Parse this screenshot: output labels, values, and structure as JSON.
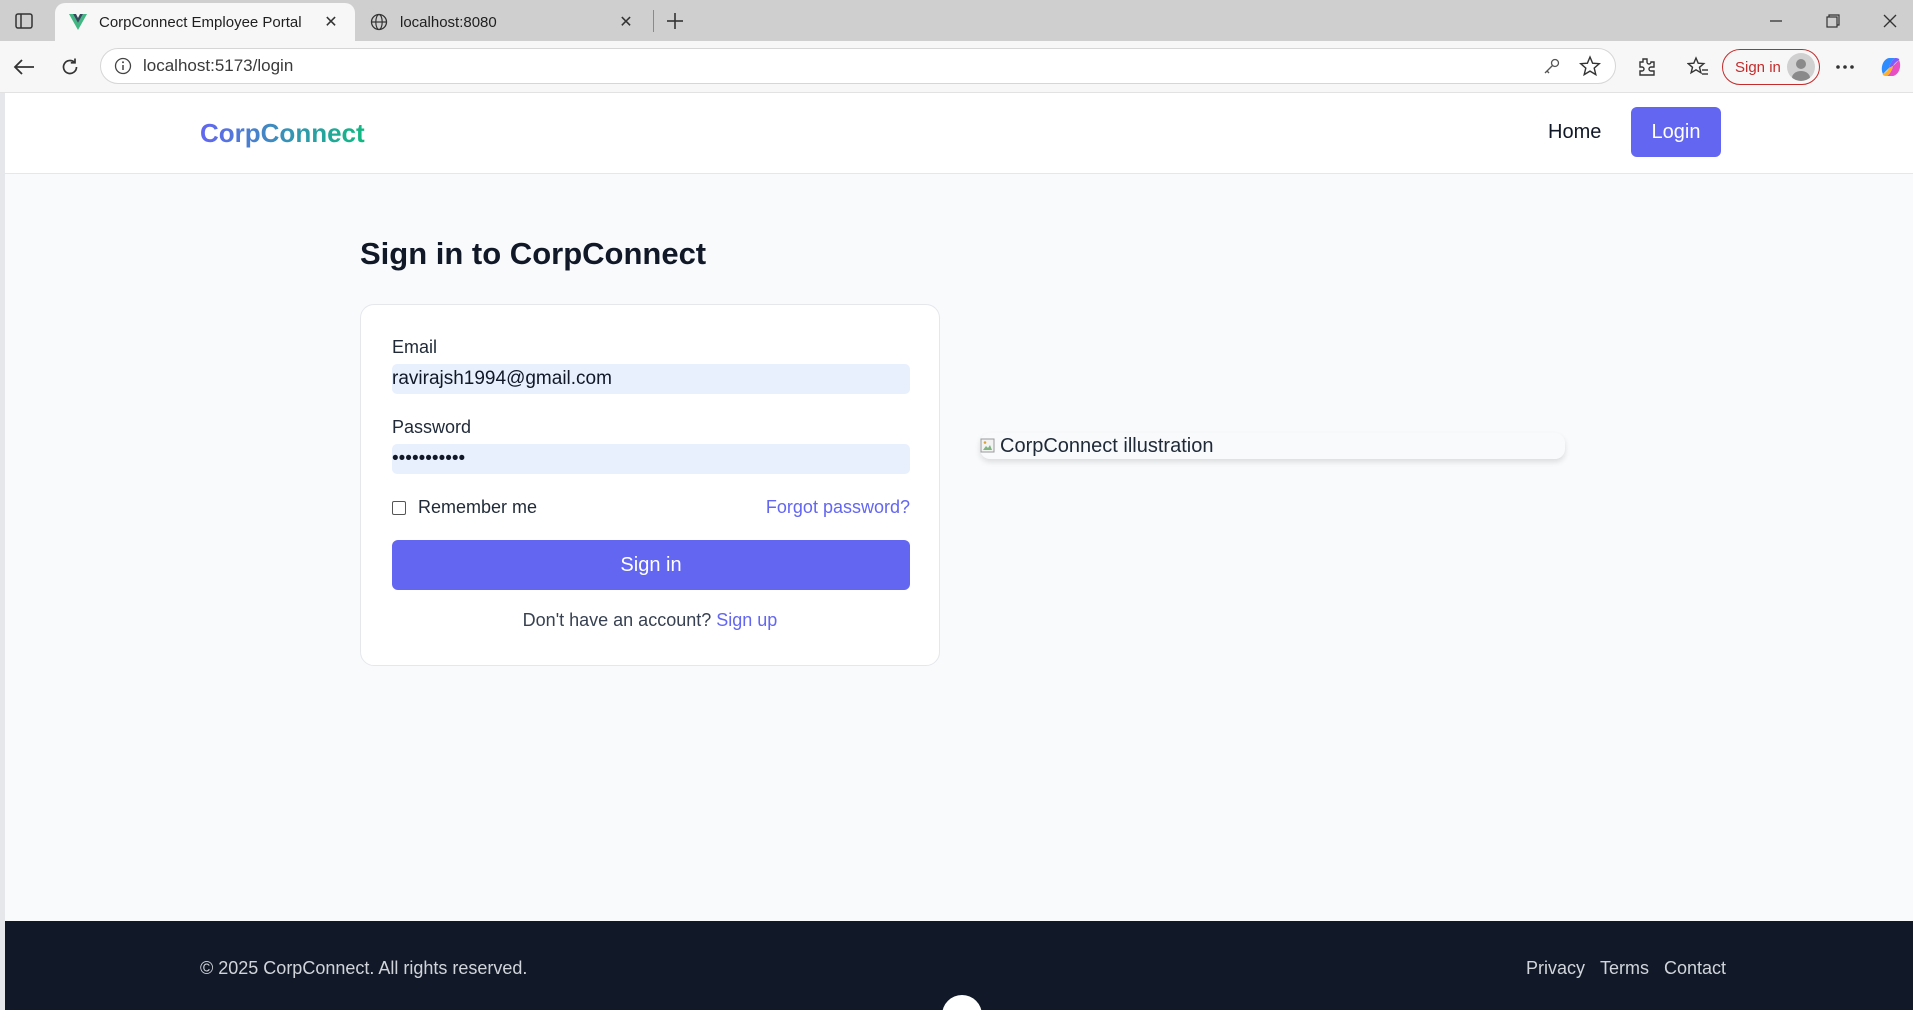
{
  "browser": {
    "tabs": [
      {
        "title": "CorpConnect Employee Portal",
        "active": true,
        "favicon": "vue-logo-icon"
      },
      {
        "title": "localhost:8080",
        "active": false,
        "favicon": "globe-icon"
      }
    ],
    "url": "localhost:5173/login",
    "profile_signin_label": "Sign in"
  },
  "header": {
    "brand": "CorpConnect",
    "nav": {
      "home": "Home",
      "login": "Login"
    }
  },
  "login": {
    "heading": "Sign in to CorpConnect",
    "email_label": "Email",
    "email_value": "ravirajsh1994@gmail.com",
    "password_label": "Password",
    "password_masked": "•••••••••••",
    "remember_label": "Remember me",
    "remember_checked": false,
    "forgot_label": "Forgot password?",
    "submit_label": "Sign in",
    "signup_prompt": "Don't have an account?",
    "signup_link": "Sign up"
  },
  "illustration": {
    "alt": "CorpConnect illustration"
  },
  "footer": {
    "copyright": "© 2025 CorpConnect. All rights reserved.",
    "links": [
      "Privacy",
      "Terms",
      "Contact"
    ]
  },
  "colors": {
    "primary": "#6366f1",
    "brand_gradient_end": "#10b981",
    "footer_bg": "#111827",
    "autofill_bg": "#e8f0fe"
  }
}
